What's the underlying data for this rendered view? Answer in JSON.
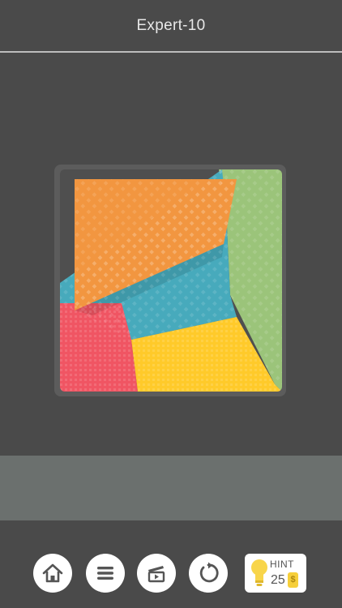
{
  "header": {
    "title": "Expert-10"
  },
  "board": {
    "colors": {
      "background": "#4f4f4f",
      "green": "#9bc47a",
      "blue": "#47aabc",
      "red": "#f05563",
      "yellow": "#ffca2a",
      "orange": "#f29640"
    }
  },
  "toolbar": {
    "home_icon": "home-icon",
    "menu_icon": "menu-icon",
    "video_icon": "video-icon",
    "restart_icon": "restart-icon",
    "hint": {
      "label": "HINT",
      "count": "25",
      "coin_symbol": "$"
    }
  }
}
